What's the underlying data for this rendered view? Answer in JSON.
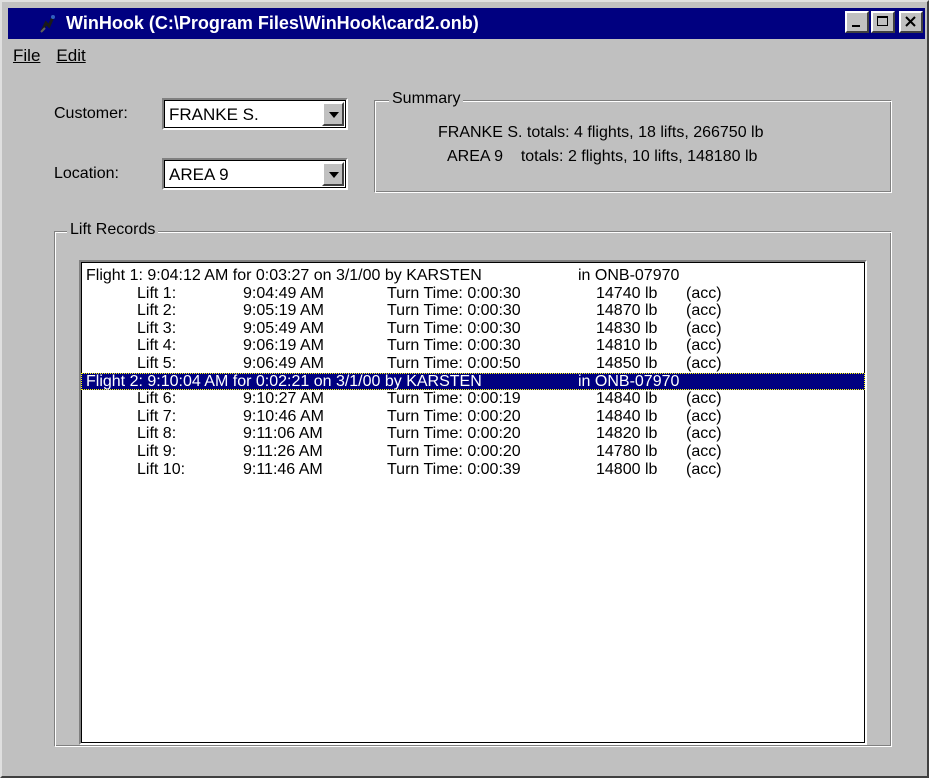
{
  "window": {
    "title": "WinHook (C:\\Program Files\\WinHook\\card2.onb)"
  },
  "menu": {
    "file": "File",
    "edit": "Edit"
  },
  "filters": {
    "customer_label": "Customer:",
    "customer_value": "FRANKE S.",
    "location_label": "Location:",
    "location_value": "AREA 9"
  },
  "summary": {
    "legend": "Summary",
    "line1": "FRANKE S. totals: 4 flights, 18 lifts, 266750 lb",
    "line2": "AREA 9    totals: 2 flights, 10 lifts, 148180 lb"
  },
  "lift_records": {
    "legend": "Lift Records",
    "flights": [
      {
        "header": "Flight 1: 9:04:12 AM for 0:03:27 on 3/1/00 by KARSTEN",
        "aircraft": "in ONB-07970",
        "selected": false,
        "lifts": [
          {
            "lift": "Lift  1:",
            "time": "9:04:49 AM",
            "turn": "Turn Time: 0:00:30",
            "weight": "14740 lb",
            "status": "(acc)"
          },
          {
            "lift": "Lift  2:",
            "time": "9:05:19 AM",
            "turn": "Turn Time: 0:00:30",
            "weight": "14870 lb",
            "status": "(acc)"
          },
          {
            "lift": "Lift  3:",
            "time": "9:05:49 AM",
            "turn": "Turn Time: 0:00:30",
            "weight": "14830 lb",
            "status": "(acc)"
          },
          {
            "lift": "Lift  4:",
            "time": "9:06:19 AM",
            "turn": "Turn Time: 0:00:30",
            "weight": "14810 lb",
            "status": "(acc)"
          },
          {
            "lift": "Lift  5:",
            "time": "9:06:49 AM",
            "turn": "Turn Time: 0:00:50",
            "weight": "14850 lb",
            "status": "(acc)"
          }
        ]
      },
      {
        "header": "Flight 2: 9:10:04 AM for 0:02:21 on 3/1/00 by KARSTEN",
        "aircraft": "in ONB-07970",
        "selected": true,
        "lifts": [
          {
            "lift": "Lift  6:",
            "time": "9:10:27 AM",
            "turn": "Turn Time: 0:00:19",
            "weight": "14840 lb",
            "status": "(acc)"
          },
          {
            "lift": "Lift  7:",
            "time": "9:10:46 AM",
            "turn": "Turn Time: 0:00:20",
            "weight": "14840 lb",
            "status": "(acc)"
          },
          {
            "lift": "Lift  8:",
            "time": "9:11:06 AM",
            "turn": "Turn Time: 0:00:20",
            "weight": "14820 lb",
            "status": "(acc)"
          },
          {
            "lift": "Lift  9:",
            "time": "9:11:26 AM",
            "turn": "Turn Time: 0:00:20",
            "weight": "14780 lb",
            "status": "(acc)"
          },
          {
            "lift": "Lift 10:",
            "time": "9:11:46 AM",
            "turn": "Turn Time: 0:00:39",
            "weight": "14800 lb",
            "status": "(acc)"
          }
        ]
      }
    ]
  },
  "icons": {
    "app": "hook-icon",
    "minimize": "minimize-icon",
    "maximize": "maximize-icon",
    "close": "close-icon",
    "dropdown": "chevron-down-icon"
  }
}
